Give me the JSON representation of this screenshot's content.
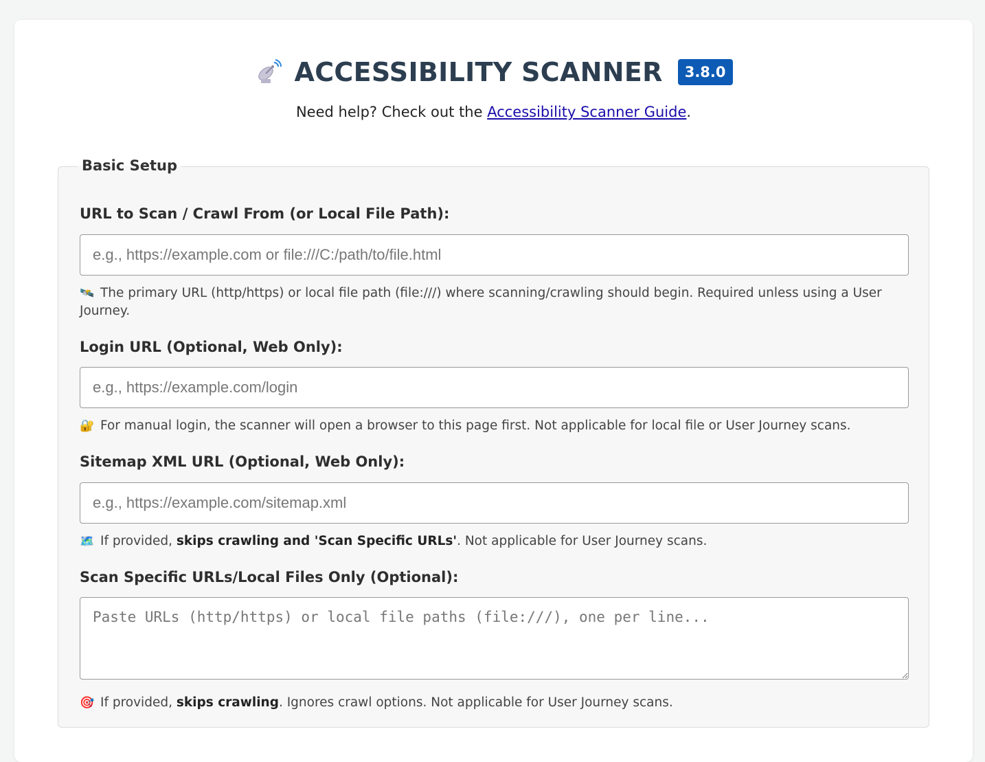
{
  "header": {
    "title": "ACCESSIBILITY SCANNER",
    "version": "3.8.0",
    "help_prefix": "Need help? Check out the ",
    "help_link": "Accessibility Scanner Guide",
    "help_suffix": "."
  },
  "basic_setup": {
    "legend": "Basic Setup",
    "url_field": {
      "label": "URL to Scan / Crawl From (or Local File Path):",
      "placeholder": "e.g., https://example.com or file:///C:/path/to/file.html",
      "value": "",
      "hint_icon": "satellite-icon",
      "hint": "The primary URL (http/https) or local file path (file:///) where scanning/crawling should begin. Required unless using a User Journey."
    },
    "login_field": {
      "label": "Login URL (Optional, Web Only):",
      "placeholder": "e.g., https://example.com/login",
      "value": "",
      "hint_icon": "lock-icon",
      "hint": "For manual login, the scanner will open a browser to this page first. Not applicable for local file or User Journey scans."
    },
    "sitemap_field": {
      "label": "Sitemap XML URL (Optional, Web Only):",
      "placeholder": "e.g., https://example.com/sitemap.xml",
      "value": "",
      "hint_icon": "map-icon",
      "hint_prefix": "If provided, ",
      "hint_bold": "skips crawling and 'Scan Specific URLs'",
      "hint_suffix": ". Not applicable for User Journey scans."
    },
    "specific_urls_field": {
      "label": "Scan Specific URLs/Local Files Only (Optional):",
      "placeholder": "Paste URLs (http/https) or local file paths (file:///), one per line...",
      "value": "",
      "hint_icon": "target-icon",
      "hint_prefix": "If provided, ",
      "hint_bold": "skips crawling",
      "hint_suffix": ". Ignores crawl options. Not applicable for User Journey scans."
    }
  },
  "colors": {
    "title": "#2c3e50",
    "version_badge": "#0d5bb5",
    "link": "#1a0dab",
    "fieldset_bg": "#f7f7f7"
  }
}
